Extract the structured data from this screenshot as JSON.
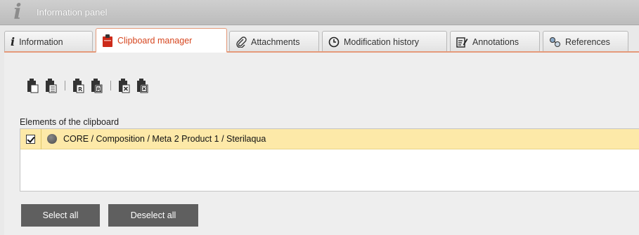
{
  "header": {
    "title": "Information panel",
    "icon": "info-icon"
  },
  "tabs": [
    {
      "label": "Information",
      "icon": "info-icon"
    },
    {
      "label": "Clipboard manager",
      "icon": "clipboard-icon",
      "active": true
    },
    {
      "label": "Attachments",
      "icon": "paperclip-icon"
    },
    {
      "label": "Modification history",
      "icon": "clock-icon"
    },
    {
      "label": "Annotations",
      "icon": "annotation-icon"
    },
    {
      "label": "References",
      "icon": "references-icon"
    }
  ],
  "toolbar": {
    "icons": [
      "paste-icon",
      "paste-list-icon",
      "paste-reference-icon",
      "paste-reference-list-icon",
      "clear-icon",
      "clear-all-icon"
    ]
  },
  "clipboard": {
    "section_label": "Elements of the clipboard",
    "items": [
      {
        "checked": true,
        "text": "CORE / Composition / Meta 2 Product 1 / Sterilaqua"
      }
    ]
  },
  "actions": {
    "select_all": "Select all",
    "deselect_all": "Deselect all"
  },
  "colors": {
    "accent": "#d6461f",
    "selected_row": "#fde9a8",
    "button_bg": "#5f5f5f"
  }
}
